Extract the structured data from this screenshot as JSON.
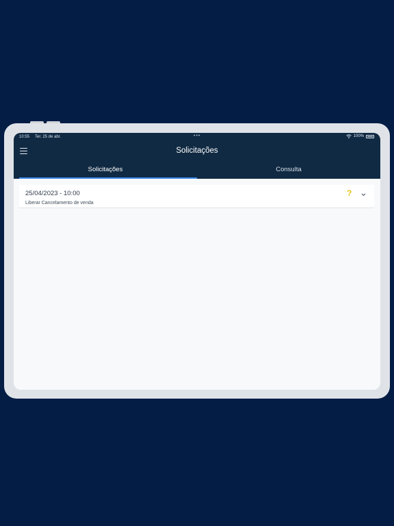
{
  "status_bar": {
    "time": "10:55",
    "date": "Ter. 25 de abr.",
    "battery": "100%"
  },
  "header": {
    "title": "Solicitações",
    "menu_icon": "hamburger-menu-icon"
  },
  "tabs": [
    {
      "label": "Solicitações",
      "active": true
    },
    {
      "label": "Consulta",
      "active": false
    }
  ],
  "requests": [
    {
      "datetime": "25/04/2023 - 10:00",
      "description": "Liberar Cancelamento de venda",
      "status_icon": "question-icon",
      "status_glyph": "?",
      "expand_icon": "chevron-down-icon"
    }
  ],
  "colors": {
    "background": "#041d45",
    "header": "#102a43",
    "active_tab_indicator": "#3a86e8",
    "pending_status": "#e8c21a"
  }
}
